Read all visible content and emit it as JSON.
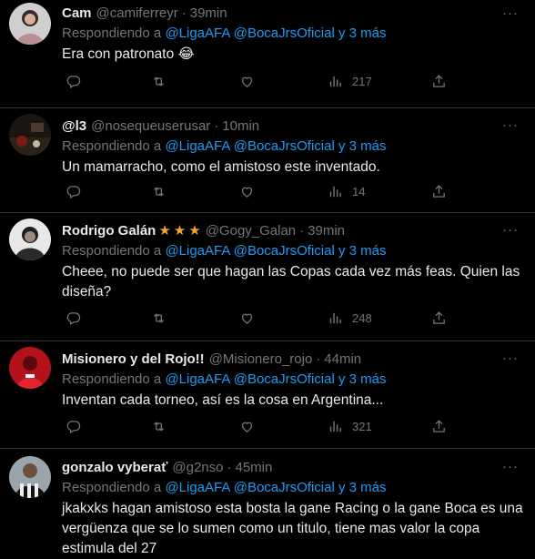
{
  "labels": {
    "replying_prefix": "Respondiendo a",
    "replying_join": "y 3 más"
  },
  "tweets": [
    {
      "name": "Cam",
      "stars": 0,
      "handle": "@camiferreyr",
      "time": "39min",
      "mention1": "@LigaAFA",
      "mention2": "@BocaJrsOficial",
      "text": "Era con patronato 😂",
      "views": "217"
    },
    {
      "name": "@l3",
      "stars": 0,
      "handle": "@nosequeuserusar",
      "time": "10min",
      "mention1": "@LigaAFA",
      "mention2": "@BocaJrsOficial",
      "text": "Un mamarracho, como el amistoso este inventado.",
      "views": "14"
    },
    {
      "name": "Rodrigo Galán",
      "stars": 3,
      "handle": "@Gogy_Galan",
      "time": "39min",
      "mention1": "@LigaAFA",
      "mention2": "@BocaJrsOficial",
      "text": "Cheee, no puede ser que hagan las Copas cada vez más feas. Quien las diseña?",
      "views": "248"
    },
    {
      "name": "Misionero y del Rojo!!",
      "stars": 0,
      "handle": "@Misionero_rojo",
      "time": "44min",
      "mention1": "@LigaAFA",
      "mention2": "@BocaJrsOficial",
      "text": "Inventan cada torneo, así es la cosa en Argentina...",
      "views": "321"
    },
    {
      "name": "gonzalo vyberať",
      "stars": 0,
      "handle": "@g2nso",
      "time": "45min",
      "mention1": "@LigaAFA",
      "mention2": "@BocaJrsOficial",
      "text": "jkakxks hagan amistoso esta bosta la gane Racing o la gane Boca es una vergüenza que se lo sumen como un titulo, tiene mas valor la copa estimula del 27",
      "views": ""
    }
  ],
  "icons": {
    "reply": "reply-icon",
    "retweet": "retweet-icon",
    "like": "like-icon",
    "views": "views-icon",
    "share": "share-icon",
    "more": "more-icon",
    "star": "star-icon"
  },
  "colors": {
    "background": "#000000",
    "text": "#e7e9ea",
    "secondary": "#71767b",
    "link": "#1d9bf0",
    "star": "#f5a623",
    "divider": "#2f3336"
  }
}
